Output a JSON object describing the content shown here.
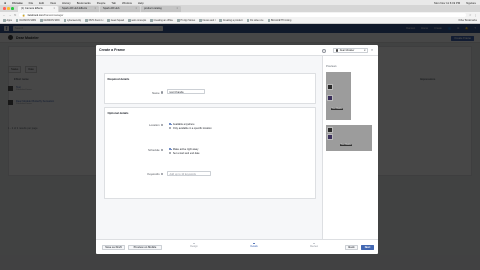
{
  "menubar": {
    "apple": "",
    "app": "Chrome",
    "items": [
      "File",
      "Edit",
      "View",
      "History",
      "Bookmarks",
      "People",
      "Tab",
      "Window",
      "Help"
    ],
    "clock": "Mon Nov 11 6:19 PM",
    "user": "Ngulore"
  },
  "tabs": [
    {
      "label": "(1) Camera Effects",
      "active": true
    },
    {
      "label": "Spark AR Hub Effects",
      "active": false
    },
    {
      "label": "Spark AR Hub",
      "active": false
    },
    {
      "label": "product catalog",
      "active": false
    }
  ],
  "address": {
    "url_host": "facebook.com",
    "url_path": "/frames/manager",
    "back": "←",
    "forward": "→",
    "reload": "↻"
  },
  "bookmarks": [
    "Apps",
    "DANSON SRIN",
    "DANSON SRN",
    "cybersecurity",
    "6670 Zoom Li",
    "Geek Squad",
    "web concepts",
    "Creating an offline",
    "Hi App Stores",
    "Nexus and I",
    "Creating a product",
    "Do video cre",
    "Bitcoin/ETH mining",
    "Other Bookmarks"
  ],
  "fb": {
    "logo": "f",
    "search_placeholder": "Search",
    "nav": [
      "Danson",
      "Home",
      "Create"
    ]
  },
  "background_page": {
    "title": "Dear Modeler",
    "create_button": "Create Frame",
    "filters": [
      "Status",
      "Date"
    ],
    "column_header": "Effect name",
    "right_header": "Impressions",
    "rows": [
      {
        "name": "Test",
        "sub": "Published frame"
      },
      {
        "name": "Dear Modeler Butterfly Sensation",
        "sub": "Published frame"
      }
    ],
    "pager": "1 - 2 of 2 results per page"
  },
  "dialog": {
    "title": "Create a Frame",
    "help": "?",
    "account_name": "Dear Modeler",
    "close": "×",
    "required_title": "Required details",
    "name_label": "Name",
    "name_value": "test Chanda",
    "optional_title": "Optional details",
    "location_label": "Location",
    "location_options": [
      {
        "label": "Available anywhere",
        "selected": true
      },
      {
        "label": "Only available in a specific location",
        "selected": false
      }
    ],
    "schedule_label": "Schedule",
    "schedule_options": [
      {
        "label": "Make active right away",
        "selected": true
      },
      {
        "label": "Set a start and end date",
        "selected": false
      }
    ],
    "keywords_label": "Keywords",
    "keywords_placeholder": "Add up to 10 keywords",
    "previews_label": "Previews",
    "preview_captions": [
      "Dear Modeler",
      "Dear Modeler"
    ],
    "save_draft": "Save as Draft",
    "preview_mobile": "Preview on Mobile",
    "steps": [
      {
        "label": "Design",
        "current": false
      },
      {
        "label": "Details",
        "current": true
      },
      {
        "label": "Review",
        "current": false
      }
    ],
    "back": "Back",
    "next": "Next",
    "accent": "#4267b2"
  }
}
